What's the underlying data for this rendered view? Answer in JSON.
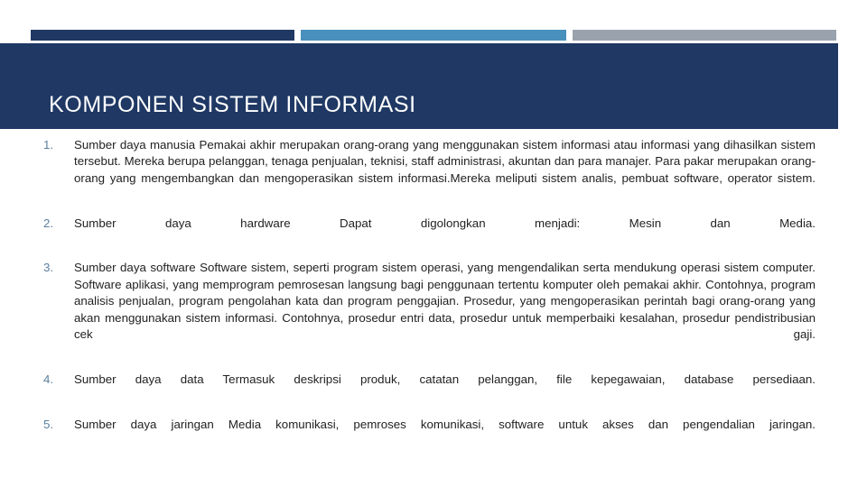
{
  "slide": {
    "title": "KOMPONEN SISTEM INFORMASI",
    "accent_rule": {
      "segment_dark_color": "#1f3864",
      "segment_mid_color": "#4a90bd",
      "segment_light_color": "#9aa3ad"
    },
    "title_band_color": "#1f3864",
    "title_text_color": "#ffffff",
    "number_color": "#5b7f9e",
    "body_text_color": "#222222",
    "background_color": "#ffffff",
    "items": [
      {
        "number": "1.",
        "text": "Sumber daya manusia  Pemakai akhir merupakan orang-orang yang menggunakan sistem informasi atau informasi yang dihasilkan sistem tersebut. Mereka berupa pelanggan, tenaga penjualan, teknisi, staff administrasi, akuntan dan para manajer. Para pakar merupakan orang-orang yang mengembangkan dan mengoperasikan sistem informasi.Mereka meliputi sistem analis, pembuat software, operator sistem."
      },
      {
        "number": "2.",
        "text": "Sumber daya hardware  Dapat digolongkan menjadi: Mesin dan Media."
      },
      {
        "number": "3.",
        "text": "Sumber daya software Software sistem, seperti program sistem operasi, yang mengendalikan serta mendukung operasi sistem computer. Software aplikasi, yang memprogram pemrosesan langsung bagi penggunaan tertentu komputer oleh pemakai akhir. Contohnya, program analisis penjualan, program pengolahan kata dan program penggajian. Prosedur, yang mengoperasikan perintah bagi orang-orang yang akan menggunakan sistem informasi. Contohnya, prosedur entri data, prosedur untuk memperbaiki kesalahan, prosedur pendistribusian cek gaji."
      },
      {
        "number": "4.",
        "text": "Sumber daya data Termasuk deskripsi produk, catatan pelanggan, file kepegawaian, database persediaan."
      },
      {
        "number": "5.",
        "text": "Sumber daya jaringan  Media komunikasi, pemroses komunikasi, software untuk akses dan pengendalian jaringan."
      }
    ]
  }
}
